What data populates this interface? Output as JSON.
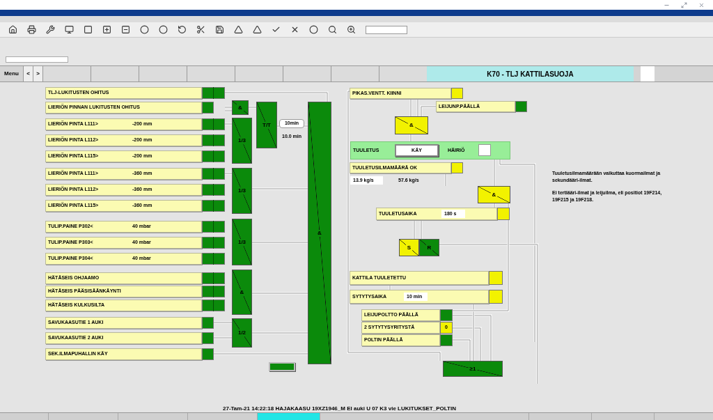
{
  "header": {
    "menu": "Menu",
    "back": "<",
    "forward": ">",
    "title": "K70 - TLJ KATTILASUOJA"
  },
  "interlocks": [
    {
      "label": "TLJ-LUKITUSTEN OHITUS",
      "kind": "double",
      "active": true
    },
    {
      "label": "LIERIÖN PINNAN LUKITUSTEN OHITUS",
      "kind": "single",
      "active": true
    },
    {
      "label": "LIERIÖN PINTA L111>",
      "value": "-200 mm",
      "kind": "double",
      "active": true
    },
    {
      "label": "LIERIÖN PINTA L112>",
      "value": "-200 mm",
      "kind": "double",
      "active": true
    },
    {
      "label": "LIERIÖN PINTA L115>",
      "value": "-200 mm",
      "kind": "double",
      "active": true
    },
    {
      "label": "LIERIÖN PINTA L111>",
      "value": "-360 mm",
      "kind": "double",
      "active": true
    },
    {
      "label": "LIERIÖN PINTA L112>",
      "value": "-360 mm",
      "kind": "double",
      "active": true
    },
    {
      "label": "LIERIÖN PINTA L115>",
      "value": "-360 mm",
      "kind": "double",
      "active": true
    },
    {
      "label": "TULIP.PAINE P302<",
      "value": "40 mbar",
      "kind": "double",
      "active": true
    },
    {
      "label": "TULIP.PAINE P303<",
      "value": "40 mbar",
      "kind": "double",
      "active": true
    },
    {
      "label": "TULIP.PAINE P304<",
      "value": "40 mbar",
      "kind": "double",
      "active": true
    },
    {
      "label": "HÄTÄSEIS OHJAAMO",
      "kind": "double",
      "active": true
    },
    {
      "label": "HÄTÄSEIS PÄÄSISÄÄNKÄYNTI",
      "kind": "double",
      "active": true
    },
    {
      "label": "HÄTÄSEIS KULKUSILTA",
      "kind": "double",
      "active": true
    },
    {
      "label": "SAVUKAASUTIE 1 AUKI",
      "kind": "single",
      "active": true
    },
    {
      "label": "SAVUKAASUTIE 2 AUKI",
      "kind": "single",
      "active": true
    },
    {
      "label": "SEK.ILMAPUHALLIN KÄY",
      "kind": "single",
      "active": true
    }
  ],
  "gates": [
    {
      "label": "&",
      "active": true
    },
    {
      "label": "1/3",
      "active": true
    },
    {
      "label": "1/3",
      "active": true
    },
    {
      "label": "1/3",
      "active": true
    },
    {
      "label": "&",
      "active": true
    },
    {
      "label": "1/2",
      "active": true
    },
    {
      "label": "T/T",
      "active": true
    },
    {
      "label": "&",
      "active": true
    }
  ],
  "timer": {
    "setpoint": "10min",
    "elapsed": "10.0 min"
  },
  "sequence": {
    "fast_valve": {
      "label": "PIKAS.VENTT. KIINNI",
      "active": false
    },
    "fluid_fan": {
      "label": "LEIJUNP.PÄÄLLÄ",
      "active": true
    },
    "gate_1": {
      "label": "&",
      "active": false
    },
    "purge": {
      "label": "TUULETUS",
      "button": "KÄY",
      "fault_label": "HÄIRIÖ",
      "fault": false
    },
    "air_flow": {
      "label": "TUULETUSILMAMÄÄRÄ OK",
      "active": false,
      "measured": "13.9 kg/s",
      "limit": "57.6 kg/s"
    },
    "gate_2": {
      "label": "&",
      "active": false
    },
    "purge_time": {
      "label": "TUULETUSAIKA",
      "value": "180 s",
      "active": false
    },
    "flipflop": [
      {
        "label": "S",
        "active": false
      },
      {
        "label": "R",
        "active": true
      }
    ],
    "boiler_purged": {
      "label": "KATTILA TUULETETTU",
      "active": false
    },
    "ignition_time": {
      "label": "SYTYTYSAIKA",
      "value": "10 min",
      "active": false
    },
    "burner": [
      {
        "label": "LEIJUPOLTTO PÄÄLLÄ",
        "active": true
      },
      {
        "label": "2 SYTYTYSYRITYSTÄ",
        "value": "0",
        "active": false
      },
      {
        "label": "POLTIN PÄÄLLÄ",
        "active": true
      }
    ],
    "gate_3": {
      "label": "≥1",
      "active": true
    }
  },
  "note": [
    "Tuuletusilmamäärään vaikuttaa kuormailmat ja sekundääri-ilmat.",
    "Ei tertiääri-ilmat ja leijuilma, eli positiot 19F214, 19F215 ja 19F218."
  ],
  "alarm_line": "27-Tam-21 14:22:18 HAJAKAASU 19XZ1946_M El auki U 07 K3 vie LUKITUKSET_POLTIN"
}
